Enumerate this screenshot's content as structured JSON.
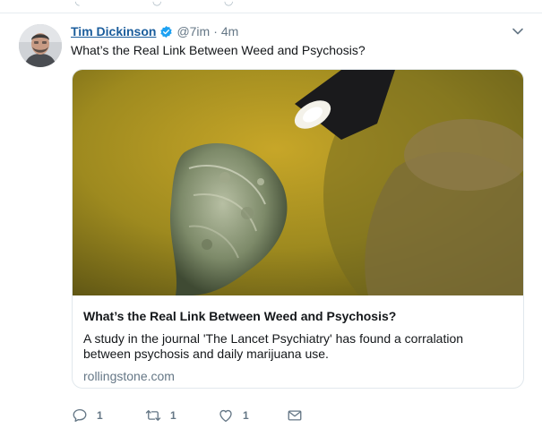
{
  "tweet": {
    "author_name": "Tim Dickinson",
    "handle": "@7im",
    "separator": "·",
    "time": "4m",
    "text": "What’s the Real Link Between Weed and Psychosis?"
  },
  "card": {
    "title": "What’s the Real Link Between Weed and Psychosis?",
    "description": "A study in the journal 'The Lancet Psychiatry' has found a corralation between psychosis and daily marijuana use.",
    "domain": "rollingstone.com"
  },
  "actions": {
    "reply_count": "1",
    "retweet_count": "1",
    "like_count": "1"
  },
  "icons": {
    "verified": "verified-badge-icon",
    "caret": "chevron-down-icon",
    "reply": "reply-icon",
    "retweet": "retweet-icon",
    "like": "heart-icon",
    "dm": "envelope-icon"
  },
  "colors": {
    "name_link": "#1b5d9c",
    "verified_badge": "#1da1f2",
    "secondary_text": "#657786",
    "border": "#e1e8ed"
  }
}
